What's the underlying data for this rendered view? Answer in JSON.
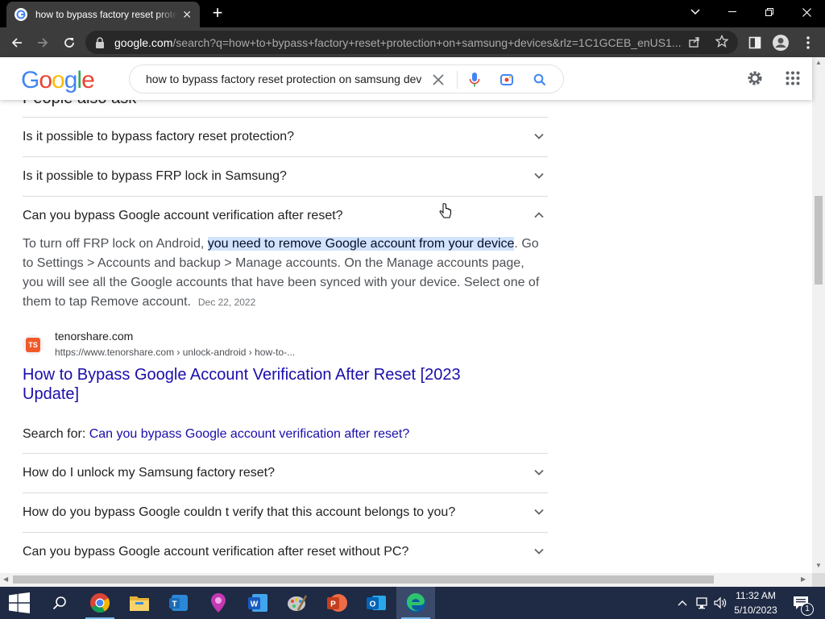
{
  "browser": {
    "tab_title": "how to bypass factory reset protection on samsung devices",
    "url_host": "google.com",
    "url_rest": "/search?q=how+to+bypass+factory+reset+protection+on+samsung+devices&rlz=1C1GCEB_enUS1..."
  },
  "google": {
    "logo_letters": [
      "G",
      "o",
      "o",
      "g",
      "l",
      "e"
    ],
    "search_query": "how to bypass factory reset protection on samsung devices"
  },
  "paa": {
    "title": "People also ask",
    "questions_top": [
      "Is it possible to bypass factory reset protection?",
      "Is it possible to bypass FRP lock in Samsung?",
      "Can you bypass Google account verification after reset?"
    ],
    "answer": {
      "pre": "To turn off FRP lock on Android, ",
      "highlight": "you need to remove Google account from your device",
      "post": ". Go to Settings > Accounts and backup > Manage accounts. On the Manage accounts page, you will see all the Google accounts that have been synced with your device. Select one of them to tap Remove account.",
      "date": "Dec 22, 2022"
    },
    "source": {
      "icon_text": "TS",
      "site": "tenorshare.com",
      "url": "https://www.tenorshare.com › unlock-android › how-to-...",
      "title": "How to Bypass Google Account Verification After Reset [2023 Update]"
    },
    "search_for": {
      "label": "Search for: ",
      "query": "Can you bypass Google account verification after reset?"
    },
    "questions_bottom": [
      "How do I unlock my Samsung factory reset?",
      "How do you bypass Google couldn t verify that this account belongs to you?",
      "Can you bypass Google account verification after reset without PC?"
    ]
  },
  "taskbar": {
    "apps": [
      "start-icon",
      "search-icon",
      "chrome-icon",
      "file-explorer-icon",
      "teams-icon",
      "maps-icon",
      "word-icon",
      "paint-icon",
      "powerpoint-icon",
      "outlook-icon",
      "edge-icon"
    ],
    "time": "11:32 AM",
    "date": "5/10/2023",
    "notification_count": "1"
  },
  "colors": {
    "google_blue": "#4285f4",
    "google_red": "#ea4335",
    "google_yellow": "#fbbc05",
    "google_green": "#34a853",
    "link": "#1a0dab",
    "highlight": "#d2e3fc"
  }
}
